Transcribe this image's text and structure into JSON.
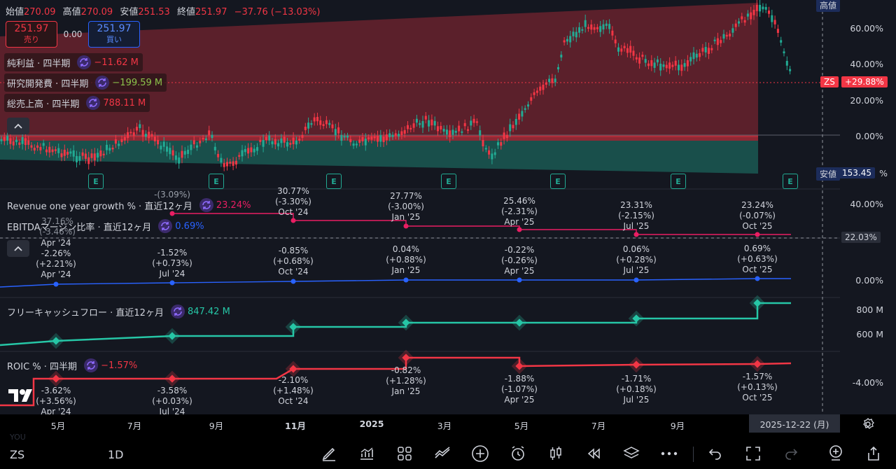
{
  "ohlc": {
    "open_label": "始値",
    "open": "270.09",
    "high_label": "高値",
    "high": "270.09",
    "low_label": "安値",
    "low": "251.53",
    "close_label": "終値",
    "close": "251.97",
    "change": "−37.76 (−13.03%)"
  },
  "sell": {
    "price": "251.97",
    "label": "売り"
  },
  "buy": {
    "price": "251.97",
    "label": "買い"
  },
  "spread": "0.00",
  "legends": [
    {
      "title": "純利益 · 四半期",
      "value": "−11.62 M",
      "color": "#f23645"
    },
    {
      "title": "研究開発費 · 四半期",
      "value": "−199.59 M",
      "color": "#8bc34a"
    },
    {
      "title": "総売上高 · 四半期",
      "value": "788.11 M",
      "color": "#f23645"
    }
  ],
  "earnings_mark": "E",
  "price_axis": {
    "top_label": "高値",
    "ticks": [
      "60.00%",
      "40.00%",
      "20.00%",
      "0.00%"
    ],
    "symbol_tag": "ZS",
    "symbol_value": "+29.88%",
    "low_label": "安値",
    "low_value": "153.45",
    "low_suffix": "%"
  },
  "revenue_pane": {
    "title": "Revenue one year growth % · 直近12ヶ月",
    "value": "23.24%",
    "axis": [
      "40.00%"
    ],
    "current_tag": "22.03%",
    "points": [
      {
        "l1": "-(3.09%)",
        "l2": "Apr '24"
      },
      {
        "l1": "30.77%",
        "l2": "(-3.30%)",
        "l3": "Oct '24"
      },
      {
        "l1": "27.77%",
        "l2": "(-3.00%)",
        "l3": "Jan '25"
      },
      {
        "l1": "25.46%",
        "l2": "(-2.31%)",
        "l3": "Apr '25"
      },
      {
        "l1": "23.31%",
        "l2": "(-2.15%)",
        "l3": "Jul '25"
      },
      {
        "l1": "23.24%",
        "l2": "(-0.07%)",
        "l3": "Oct '25"
      }
    ],
    "overlap_text": "37.16%",
    "overlap_text2": "(-3.46%)"
  },
  "ebitda_pane": {
    "title": "EBITDAマージン比率 · 直近12ヶ月",
    "value": "0.69%",
    "axis": [
      "0.00%"
    ],
    "points": [
      {
        "l1": "-2.26%",
        "l2": "(+2.21%)",
        "l3": "Apr '24",
        "top": "Apr '24"
      },
      {
        "l1": "-1.52%",
        "l2": "(+0.73%)",
        "l3": "Jul '24"
      },
      {
        "l1": "-0.85%",
        "l2": "(+0.68%)",
        "l3": "Oct '24"
      },
      {
        "l1": "0.04%",
        "l2": "(+0.88%)",
        "l3": "Jan '25"
      },
      {
        "l1": "-0.22%",
        "l2": "(-0.26%)",
        "l3": "Apr '25"
      },
      {
        "l1": "0.06%",
        "l2": "(+0.28%)",
        "l3": "Jul '25"
      },
      {
        "l1": "0.69%",
        "l2": "(+0.63%)",
        "l3": "Oct '25"
      }
    ]
  },
  "fcf_pane": {
    "title": "フリーキャッシュフロー · 直近12ヶ月",
    "value": "847.42 M",
    "axis": [
      "800 M",
      "600 M"
    ]
  },
  "roic_pane": {
    "title": "ROIC % · 四半期",
    "value": "−1.57%",
    "axis": [
      "-4.00%"
    ],
    "points": [
      {
        "l1": "-3.62%",
        "l2": "(+3.56%)",
        "l3": "Apr '24"
      },
      {
        "l1": "-3.58%",
        "l2": "(+0.03%)",
        "l3": "Jul '24"
      },
      {
        "l1": "-2.10%",
        "l2": "(+1.48%)",
        "l3": "Oct '24"
      },
      {
        "l1": "-0.82%",
        "l2": "(+1.28%)",
        "l3": "Jan '25"
      },
      {
        "l1": "-1.88%",
        "l2": "(-1.07%)",
        "l3": "Apr '25"
      },
      {
        "l1": "-1.71%",
        "l2": "(+0.18%)",
        "l3": "Jul '25"
      },
      {
        "l1": "-1.57%",
        "l2": "(+0.13%)",
        "l3": "Oct '25"
      }
    ]
  },
  "x_axis": [
    "5月",
    "7月",
    "9月",
    "11月",
    "2025",
    "3月",
    "5月",
    "7月",
    "9月"
  ],
  "crosshair_date": "2025-12-22 (月)",
  "toolbar": {
    "symbol": "ZS",
    "interval": "1D",
    "logo_sub": "YOU"
  },
  "colors": {
    "bg": "#141720",
    "red": "#f23645",
    "green": "#22ab94",
    "blue": "#2962ff",
    "teal": "#26c6a6",
    "magenta": "#e91e63"
  }
}
